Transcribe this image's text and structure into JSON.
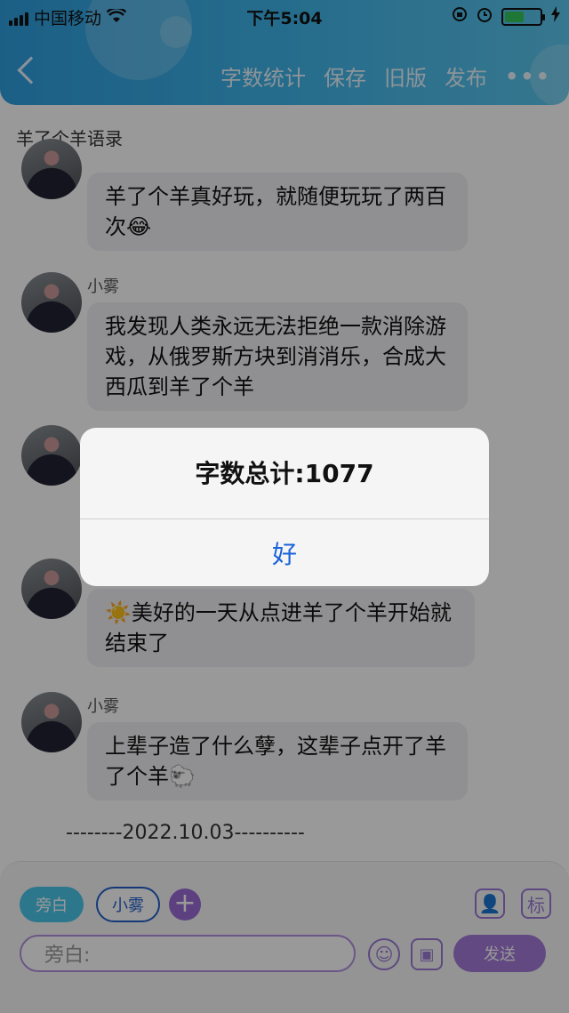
{
  "status_bar": {
    "carrier": "中国移动",
    "time": "下午5:04"
  },
  "nav": {
    "back_icon": "chevron-left-icon",
    "actions": [
      "字数统计",
      "保存",
      "旧版",
      "发布"
    ],
    "more_label": "•••"
  },
  "page": {
    "title": "羊了个羊语录"
  },
  "messages": [
    {
      "name": "",
      "text": "羊了个羊真好玩，就随便玩玩了两百次😂"
    },
    {
      "name": "小雾",
      "text": "我发现人类永远无法拒绝一款消除游戏，从俄罗斯方块到消消乐，合成大西瓜到羊了个羊"
    },
    {
      "name": "",
      "text": "☀️美好的一天从点进羊了个羊开始就结束了"
    },
    {
      "name": "小雾",
      "text": "上辈子造了什么孽，这辈子点开了羊了个羊🐑"
    }
  ],
  "date_divider": "--------2022.10.03----------",
  "composer": {
    "chips": [
      "旁白",
      "小雾"
    ],
    "add_label": "+",
    "role_icon_label": "👤",
    "tag_label": "标",
    "input_placeholder": "旁白:",
    "send_label": "发送"
  },
  "dialog": {
    "message": "字数总计:1077",
    "ok_label": "好"
  },
  "colors": {
    "header": "#3fb5ea",
    "accent_purple": "#a47ad9",
    "chip_blue": "#4cc6ea",
    "link_blue": "#1a63d8",
    "battery_green": "#35c75a"
  }
}
